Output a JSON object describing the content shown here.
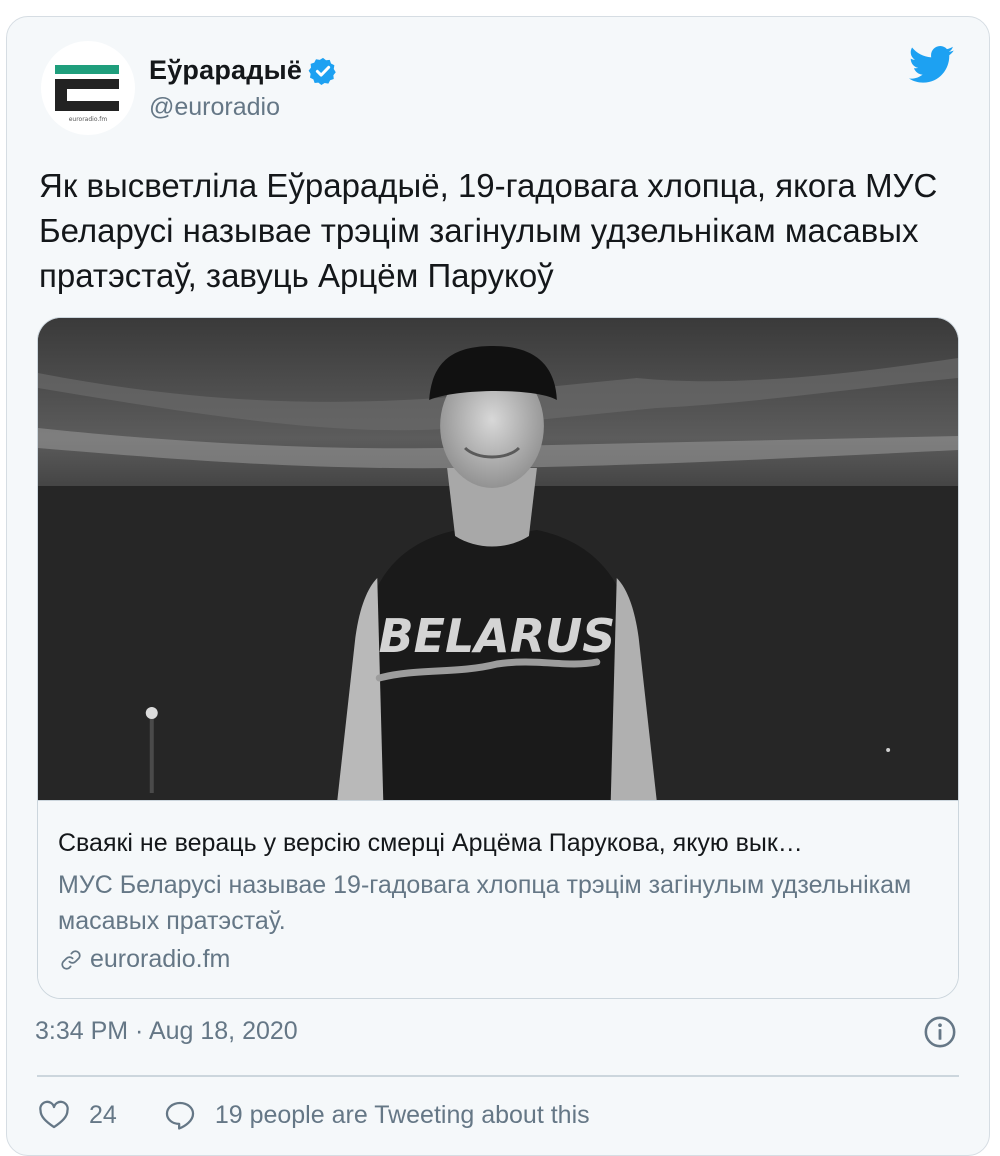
{
  "author": {
    "display_name": "Еўрарадыё",
    "handle": "@euroradio",
    "avatar_caption": "euroradio.fm",
    "verified": true
  },
  "tweet": {
    "text": "Як высветліла Еўрарадыё, 19-гадовага хлопца, якога МУС Беларусі называе трэцім загінулым удзельнікам масавых пратэстаў, завуць Арцём Парукоў",
    "timestamp": "3:34 PM · Aug 18, 2020"
  },
  "card": {
    "image_shirt_text": "BELARUS",
    "title": "Сваякі не вераць у версію смерці Арцёма Парукова, якую вык…",
    "description": "МУС Беларусі называе 19-гадовага хлопца трэцім загінулым удзельнікам масавых пратэстаў.",
    "domain": "euroradio.fm"
  },
  "actions": {
    "likes": "24",
    "conversation": "19 people are Tweeting about this"
  },
  "icons": {
    "twitter": "twitter-bird-icon",
    "verified": "verified-badge-icon",
    "link": "link-icon",
    "info": "info-icon",
    "like": "heart-icon",
    "reply": "speech-bubble-icon"
  },
  "colors": {
    "twitter_blue": "#1da1f2",
    "text_primary": "#14171a",
    "text_secondary": "#657786",
    "logo_green": "#1f9e7c",
    "logo_black": "#222222"
  }
}
